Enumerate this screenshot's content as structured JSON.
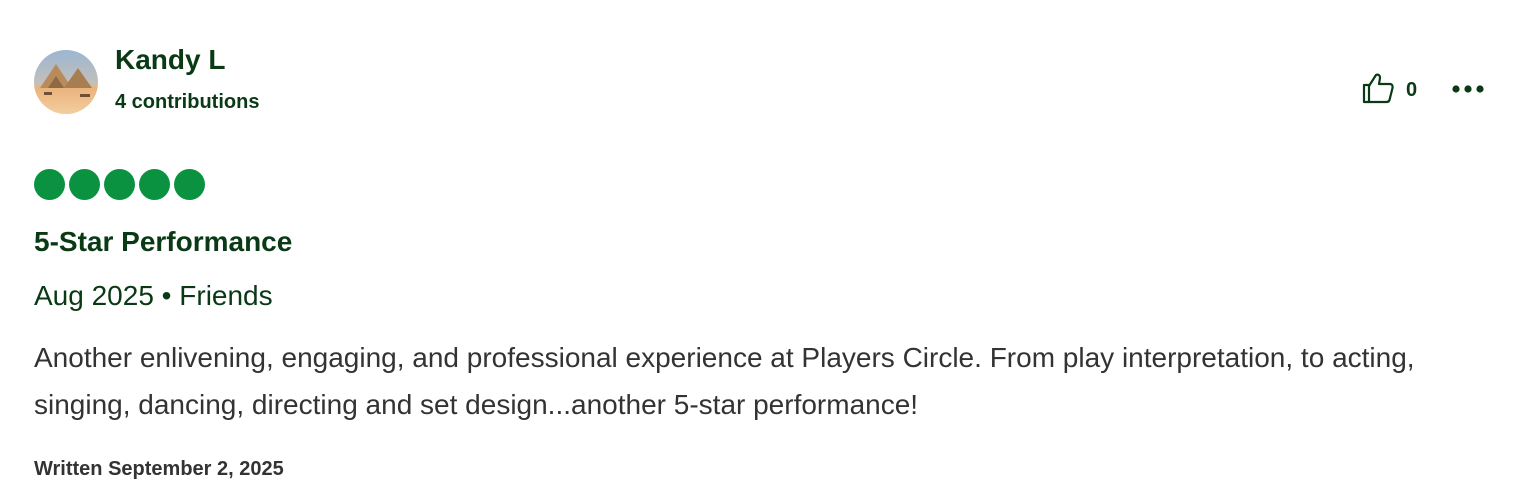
{
  "reviewer": {
    "name": "Kandy L",
    "contributions": "4 contributions",
    "avatar_icon": "avatar-photo-desert-pyramids"
  },
  "actions": {
    "helpful_icon": "thumbs-up-icon",
    "helpful_count": "0",
    "more_icon": "more-horizontal-icon"
  },
  "rating": {
    "value": 5,
    "max": 5,
    "color": "#0b9240"
  },
  "review": {
    "title": "5-Star Performance",
    "trip_date": "Aug 2025",
    "separator": " • ",
    "trip_type": "Friends",
    "text": "Another enlivening, engaging, and professional experience at Players Circle. From play interpretation, to acting, singing, dancing, directing and set design...another 5-star performance!",
    "written": "Written September 2, 2025"
  },
  "colors": {
    "primary_text": "#0a3a15",
    "body_text": "#333333",
    "bubble": "#0b9240"
  }
}
